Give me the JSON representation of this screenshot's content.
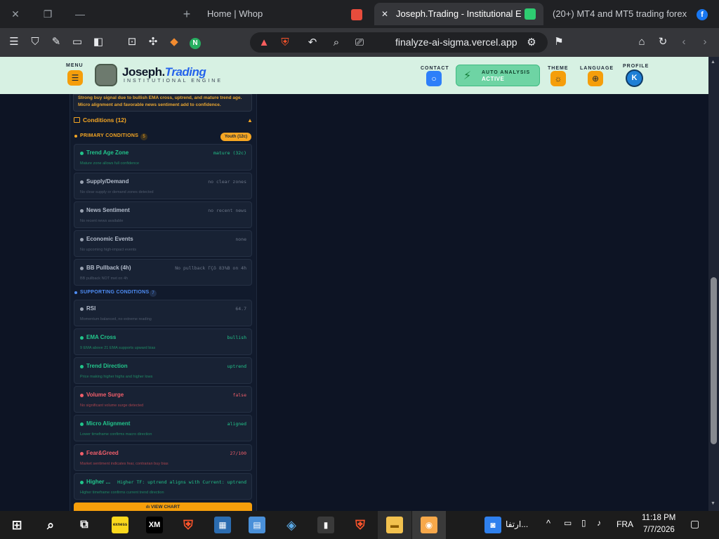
{
  "browser": {
    "tabs": [
      {
        "label": "Home | Whop"
      },
      {
        "label": "Joseph.Trading - Institutional Eng"
      },
      {
        "label": "(20+) MT4 and MT5 trading forex"
      }
    ],
    "url": "finalyze-ai-sigma.vercel.app"
  },
  "header": {
    "menu_label": "MENU",
    "brand_main": "Joseph.",
    "brand_accent": "Trading",
    "brand_sub": "INSTITUTIONAL ENGINE",
    "contact_label": "CONTACT",
    "auto_title": "AUTO ANALYSIS",
    "auto_status": "ACTIVE",
    "theme_label": "THEME",
    "language_label": "LANGUAGE",
    "profile_label": "PROFILE",
    "profile_initial": "K"
  },
  "recommendation": {
    "line1": "Strong buy signal due to bullish EMA cross, uptrend, and mature trend age.",
    "line2": "Micro alignment and favorable news sentiment add to confidence."
  },
  "conditions": {
    "header": "Conditions (12)",
    "primary": {
      "title": "PRIMARY CONDITIONS",
      "count": "5",
      "badge": "Youth (12c)",
      "items": [
        {
          "title": "Trend Age Zone",
          "value": "mature (32c)",
          "desc": "Mature zone allows full confidence",
          "status": "pass"
        },
        {
          "title": "Supply/Demand",
          "value": "no clear zones",
          "desc": "No clear supply or demand zones detected",
          "status": "neutral"
        },
        {
          "title": "News Sentiment",
          "value": "no recent news",
          "desc": "No recent news available",
          "status": "neutral"
        },
        {
          "title": "Economic Events",
          "value": "none",
          "desc": "No upcoming high-impact events",
          "status": "neutral"
        },
        {
          "title": "BB Pullback (4h)",
          "value": "No pullback ΓÇö 83%B on 4h",
          "desc": "BB pullback NOT met on 4h",
          "status": "neutral"
        }
      ]
    },
    "supporting": {
      "title": "SUPPORTING CONDITIONS",
      "count": "7",
      "items": [
        {
          "title": "RSI",
          "value": "64.7",
          "desc": "Momentum balanced, no extreme reading",
          "status": "neutral"
        },
        {
          "title": "EMA Cross",
          "value": "bullish",
          "desc": "9 EMA above 21 EMA supports upward bias",
          "status": "pass"
        },
        {
          "title": "Trend Direction",
          "value": "uptrend",
          "desc": "Price making higher highs and higher lows",
          "status": "pass"
        },
        {
          "title": "Volume Surge",
          "value": "false",
          "desc": "No significant volume surge detected",
          "status": "fail"
        },
        {
          "title": "Micro Alignment",
          "value": "aligned",
          "desc": "Lower timeframe confirms macro direction",
          "status": "pass"
        },
        {
          "title": "Fear&Greed",
          "value": "27/100",
          "desc": "Market sentiment indicates fear, contrarian buy bias",
          "status": "fail"
        },
        {
          "title": "Higher ...",
          "value": "Higher TF: uptrend aligns with Current: uptrend",
          "desc": "Higher timeframe confirms current trend direction",
          "status": "pass"
        }
      ]
    }
  },
  "view_chart_label": "VIEW CHART",
  "taskbar": {
    "app_exness": "exness",
    "app_xm": "XM",
    "tray_app_label": "ارتفا...",
    "language": "FRA",
    "time": "11:18 PM",
    "date": "7/7/2026"
  },
  "colors": {
    "pass": "#22c58b",
    "fail": "#f25f6b",
    "neutral": "#9aa3b2",
    "accent": "#f5a623",
    "supporting": "#4f8ef7"
  }
}
